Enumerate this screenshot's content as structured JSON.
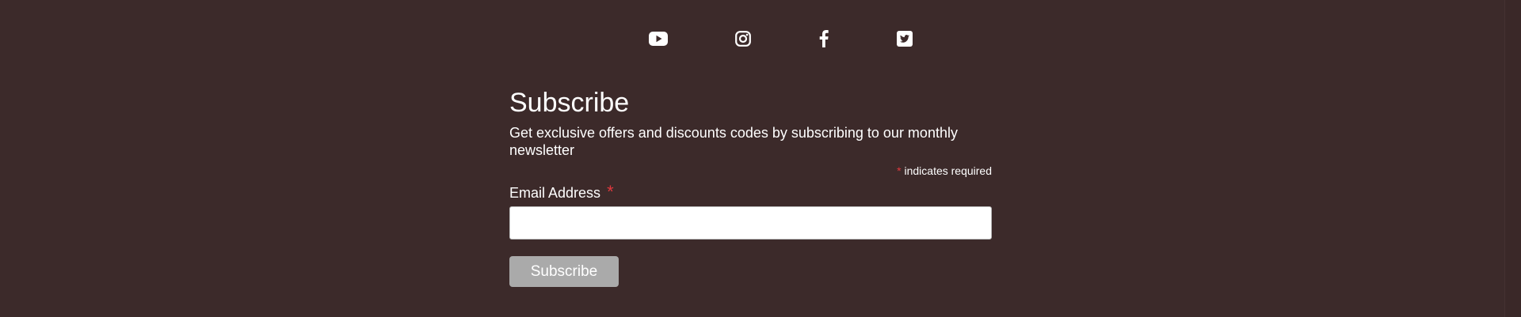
{
  "social": {
    "items": [
      {
        "icon": "youtube-icon"
      },
      {
        "icon": "instagram-icon"
      },
      {
        "icon": "facebook-icon"
      },
      {
        "icon": "twitter-icon"
      }
    ]
  },
  "subscribe": {
    "title": "Subscribe",
    "subtitle": "Get exclusive offers and discounts codes by subscribing to our monthly newsletter",
    "required_asterisk": "*",
    "required_note": "indicates required",
    "email_label": "Email Address",
    "email_value": "",
    "button_label": "Subscribe"
  },
  "colors": {
    "background": "#3c2a2a",
    "text": "#ffffff",
    "required": "#e0393e",
    "button": "#aaaaaa"
  }
}
